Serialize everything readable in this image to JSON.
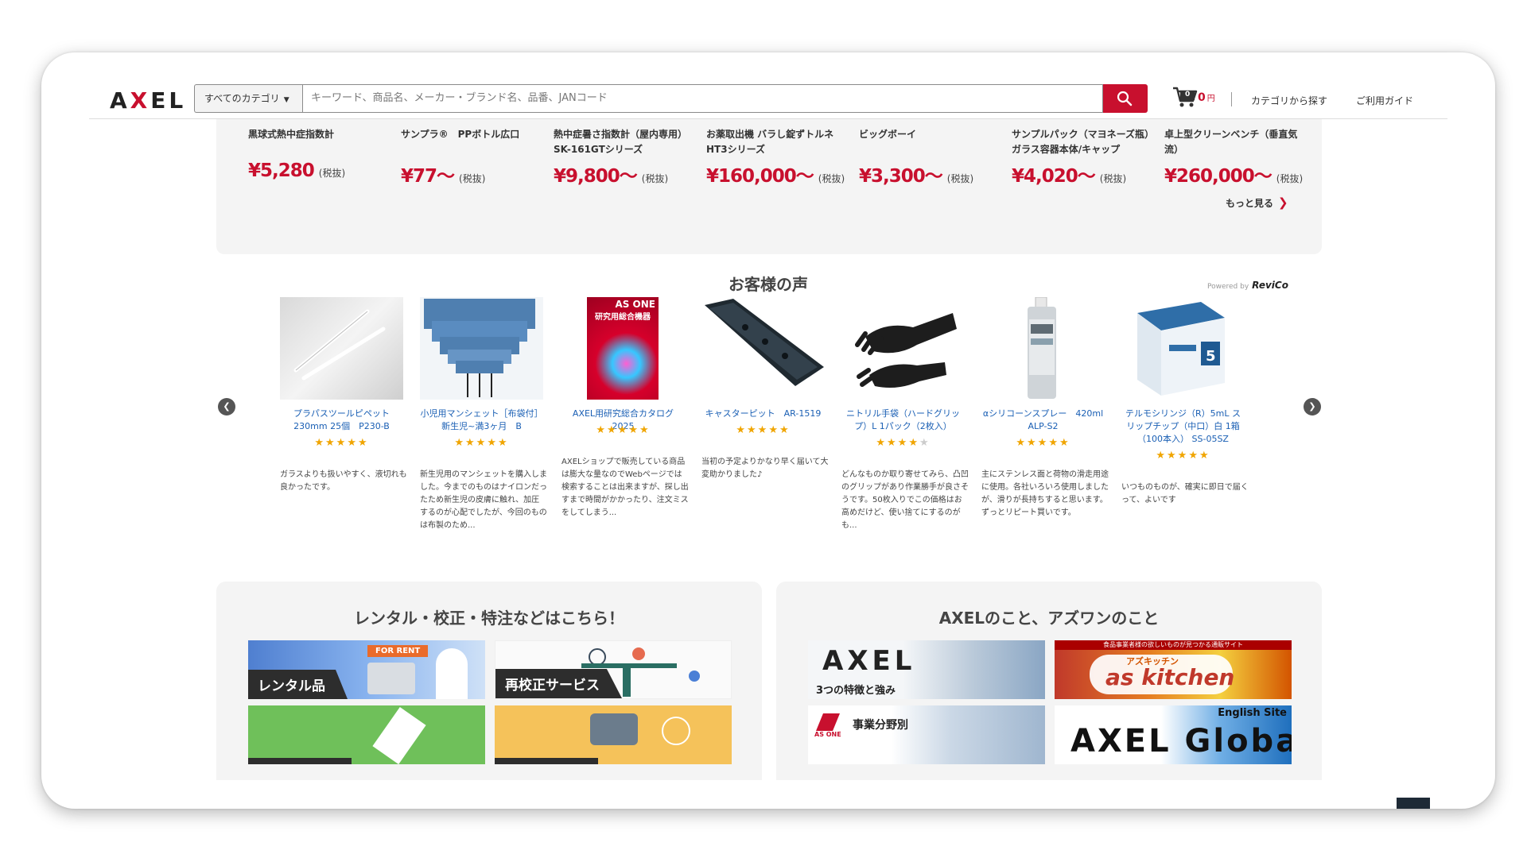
{
  "header": {
    "logo": "AXEL",
    "category_select": "すべてのカテゴリ",
    "search_placeholder": "キーワード、商品名、メーカー・ブランド名、品番、JANコード",
    "cart_count": "0",
    "cart_amount": "0",
    "cart_currency": "円",
    "links": [
      "カテゴリから探す",
      "ご利用ガイド"
    ]
  },
  "products": {
    "items": [
      {
        "name": "黒球式熱中症指数計",
        "price": "¥5,280",
        "tax": "(税抜)"
      },
      {
        "name": "サンプラ®　PPボトル広口",
        "price": "¥77〜",
        "tax": "(税抜)"
      },
      {
        "name": "熱中症暑さ指数計（屋内専用） SK-161GTシリーズ",
        "price": "¥9,800〜",
        "tax": "(税抜)"
      },
      {
        "name": "お薬取出機 バラし錠ずトルネ HT3シリーズ",
        "price": "¥160,000〜",
        "tax": "(税抜)"
      },
      {
        "name": "ビッグボーイ",
        "price": "¥3,300〜",
        "tax": "(税抜)"
      },
      {
        "name": "サンプルパック（マヨネーズ瓶）ガラス容器本体/キャップ",
        "price": "¥4,020〜",
        "tax": "(税抜)"
      },
      {
        "name": "卓上型クリーンベンチ（垂直気流）",
        "price": "¥260,000〜",
        "tax": "(税抜)"
      }
    ],
    "more_label": "もっと見る"
  },
  "reviews": {
    "title": "お客様の声",
    "powered_by": "Powered by",
    "powered_brand": "ReviCo",
    "items": [
      {
        "name": "プラパスツールピペット 230mm 25個　P230-B",
        "stars": 5,
        "text": "ガラスよりも扱いやすく、液切れも良かったです。"
      },
      {
        "name": "小児用マンシェット［布袋付］ 新生児~満3ヶ月　B",
        "stars": 5,
        "text": "新生児用のマンシェットを購入しました。今までのものはナイロンだったため新生児の皮膚に触れ、加圧するのが心配でしたが、今回のものは布製のため..."
      },
      {
        "name": "AXEL用研究総合カタログ2025",
        "stars": 5,
        "text": "AXELショップで販売している商品は膨大な量なのでWebページでは検索することは出来ますが、探し出すまで時間がかかったり、注文ミスをしてしまう..."
      },
      {
        "name": "キャスターピット　AR-1519",
        "stars": 5,
        "text": "当初の予定よりかなり早く届いて大変助かりました♪"
      },
      {
        "name": "ニトリル手袋（ハードグリップ）L 1パック（2枚入）",
        "stars": 4,
        "text": "どんなものか取り寄せてみら、凸凹のグリップがあり作業勝手が良さそうです。50枚入りでこの価格はお高めだけど、使い捨てにするのがも..."
      },
      {
        "name": "αシリコーンスプレー　420ml　ALP-S2",
        "stars": 5,
        "text": "主にステンレス面と荷物の滑走用途に使用。各社いろいろ使用しましたが、滑りが長持ちすると思います。ずっとリピート買いです。"
      },
      {
        "name": "テルモシリンジ（R）5mL スリップチップ（中口）白 1箱（100本入） SS-05SZ",
        "stars": 5,
        "text": "いつものものが、確実に即日で届くって、よいです"
      }
    ],
    "catalog_cover_line1": "AS ONE",
    "catalog_cover_line2": "研究用総合機器"
  },
  "services": {
    "title": "レンタル・校正・特注などはこちら！",
    "tiles": [
      {
        "label": "レンタル品",
        "badge": "FOR RENT"
      },
      {
        "label": "再校正サービス"
      }
    ]
  },
  "about": {
    "title": "AXELのこと、アズワンのこと",
    "tiles": [
      {
        "logo": "AXEL",
        "label": "3つの特徴と強み"
      },
      {
        "logo": "as kitchen",
        "sub": "アズキッチン",
        "top": "食品事業者様の欲しいものが見つかる通販サイト"
      },
      {
        "label": "事業分野別",
        "brand": "AS ONE"
      },
      {
        "logo": "AXEL Global",
        "badge": "English Site"
      }
    ]
  },
  "colors": {
    "accent": "#c8102e",
    "link": "#1a5fb4",
    "star": "#f0a500"
  }
}
